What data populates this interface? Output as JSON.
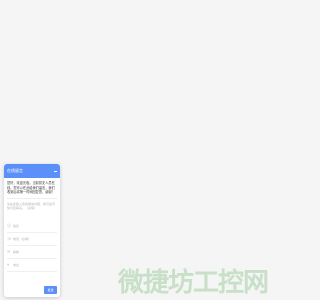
{
  "widget": {
    "title": "在线留言",
    "welcome": "您好，欢迎光临，当前暂无人员在线，您可以在此给我们留言，我们收到后将第一时间回复您，谢谢！",
    "message_placeholder": "请在此输入您的留言内容，我们会尽快与您联系。（必填）",
    "fields": [
      {
        "icon": "user-icon",
        "glyph": "☺",
        "label": "姓名"
      },
      {
        "icon": "phone-icon",
        "glyph": "☏",
        "label": "电话（必填）"
      },
      {
        "icon": "email-icon",
        "glyph": "✉",
        "label": "邮箱"
      },
      {
        "icon": "location-icon",
        "glyph": "⌖",
        "label": "地址"
      }
    ],
    "send_label": "发送"
  },
  "watermark": "微捷坊工控网",
  "colors": {
    "accent": "#5b8ff9",
    "background": "#f5f5f5"
  }
}
